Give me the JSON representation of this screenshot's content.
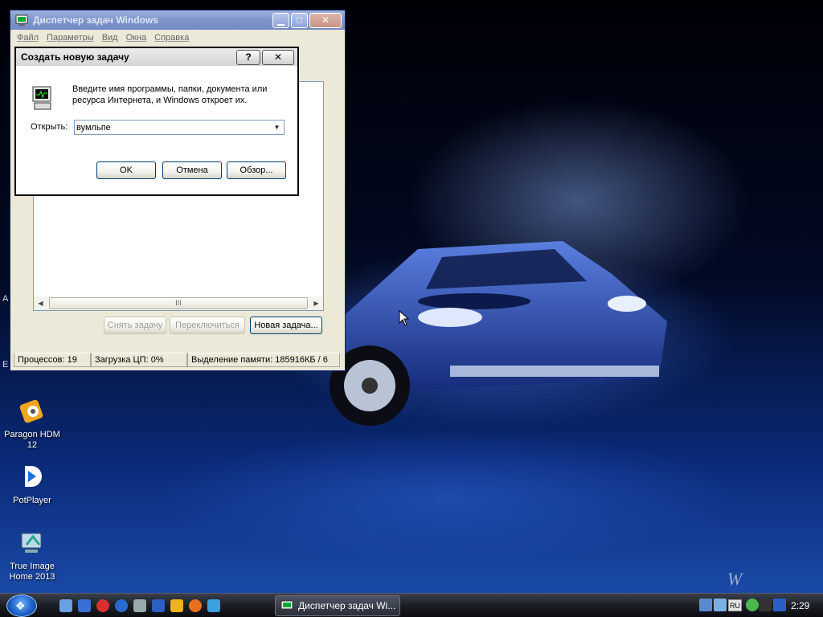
{
  "desktop": {
    "edge_glyphs": [
      "А",
      "Е"
    ],
    "icons": [
      {
        "label": "Paragon HDM 12",
        "icon": "paragon-icon"
      },
      {
        "label": "PotPlayer",
        "icon": "potplayer-icon"
      },
      {
        "label": "True Image Home 2013",
        "icon": "true-image-icon"
      }
    ],
    "watermark": "W"
  },
  "task_manager": {
    "title": "Диспетчер задач Windows",
    "menu": [
      "Файл",
      "Параметры",
      "Вид",
      "Окна",
      "Справка"
    ],
    "scroll_thumb": "III",
    "buttons": {
      "end_task": "Снять задачу",
      "switch_to": "Переключиться",
      "new_task": "Новая задача..."
    },
    "status": {
      "processes": "Процессов: 19",
      "cpu": "Загрузка ЦП: 0%",
      "memory": "Выделение памяти: 185916КБ / 6"
    }
  },
  "run_dialog": {
    "title": "Создать новую задачу",
    "help_btn": "?",
    "close_btn": "✕",
    "description": "Введите имя программы, папки, документа или ресурса Интернета, и Windows откроет их.",
    "open_label": "Открыть:",
    "open_value": "вумльпе",
    "buttons": {
      "ok": "OK",
      "cancel": "Отмена",
      "browse": "Обзор..."
    }
  },
  "taskbar": {
    "active_task": "Диспетчер задач Wi...",
    "language": "RU",
    "clock": "2:29"
  }
}
